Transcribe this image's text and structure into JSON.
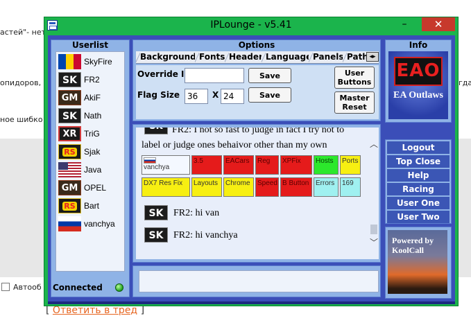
{
  "background": {
    "line1": "астей\"- нет",
    "line2": "опидоров,",
    "line2_right": "гда",
    "line3": "ное шибко",
    "checkbox_label": "Автооб",
    "reply_link": "Ответить в тред",
    "bracket_open": "[",
    "bracket_close": "]"
  },
  "window": {
    "title": "IPLounge - v5.41",
    "minimize": "–",
    "maximize": "□",
    "close": "✕"
  },
  "userlist": {
    "header": "Userlist",
    "users": [
      {
        "name": "SkyFire",
        "icon": "moldova-flag-icon",
        "badge": ""
      },
      {
        "name": "FR2",
        "icon": "sk-logo-icon",
        "badge": "SK"
      },
      {
        "name": "AkiF",
        "icon": "gm-logo-icon",
        "badge": "GM"
      },
      {
        "name": "Nath",
        "icon": "sk-logo-icon",
        "badge": "SK"
      },
      {
        "name": "TriG",
        "icon": "xr-logo-icon",
        "badge": "XR"
      },
      {
        "name": "Sjak",
        "icon": "rs-logo-icon",
        "badge": "RS"
      },
      {
        "name": "Java",
        "icon": "usa-flag-icon",
        "badge": ""
      },
      {
        "name": "OPEL",
        "icon": "gm-logo-icon",
        "badge": "GM"
      },
      {
        "name": "Bart",
        "icon": "rs-logo-icon",
        "badge": "RS"
      },
      {
        "name": "vanchya",
        "icon": "russia-flag-icon",
        "badge": ""
      }
    ],
    "status": "Connected"
  },
  "options": {
    "header": "Options",
    "tabs": [
      "Background",
      "Fonts",
      "Header",
      "Language",
      "Panels",
      "Path"
    ],
    "override_ip_label": "Override IP",
    "override_ip_value": "",
    "flag_size_label": "Flag Size",
    "flag_w": "36",
    "flag_x": "X",
    "flag_h": "24",
    "save1": "Save",
    "save2": "Save",
    "user_buttons": "User Buttons",
    "master_reset": "Master Reset"
  },
  "chat": {
    "msg_top": "FR2: I not so fast to judge in fact I try not to",
    "msg_top2": "label or judge ones behaivor other than my own",
    "badge_row1": [
      {
        "text": "vanchya",
        "color": "white"
      },
      {
        "text": "3.5",
        "color": "red"
      },
      {
        "text": "EACars",
        "color": "red"
      },
      {
        "text": "Reg",
        "color": "red"
      },
      {
        "text": "XPFix",
        "color": "red"
      },
      {
        "text": "Hosts",
        "color": "green"
      },
      {
        "text": "Ports",
        "color": "yellow"
      }
    ],
    "badge_row2": [
      {
        "text": "DX7 Res Fix",
        "color": "yellow"
      },
      {
        "text": "Layouts",
        "color": "yellow"
      },
      {
        "text": "Chrome",
        "color": "yellow"
      },
      {
        "text": "Speed",
        "color": "red"
      },
      {
        "text": "B Button",
        "color": "red"
      },
      {
        "text": "Errors",
        "color": "cyan"
      },
      {
        "text": "169",
        "color": "cyan"
      }
    ],
    "msg1": "FR2: hi van",
    "msg2": "FR2: hi vanchya",
    "sk": "SK"
  },
  "info": {
    "header": "Info",
    "logo": "EAO",
    "logo_caption": "EA Outlaws"
  },
  "menu": [
    "Logout",
    "Top Close",
    "Help",
    "Racing",
    "User One",
    "User Two"
  ],
  "powered": {
    "line1": "Powered by",
    "line2": "KoolCall"
  },
  "colors": {
    "titlebar": "#1bb44c",
    "client": "#3b4eb8",
    "panel": "#8fb3e6",
    "close_button": "#c7392c"
  }
}
